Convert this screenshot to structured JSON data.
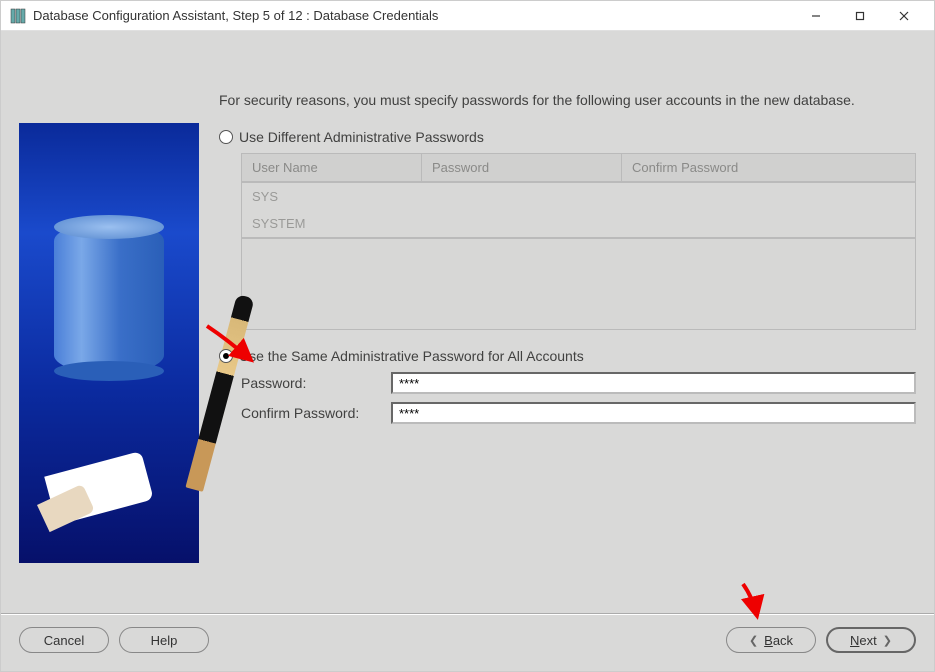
{
  "window": {
    "title": "Database Configuration Assistant, Step 5 of 12 : Database Credentials"
  },
  "content": {
    "intro": "For security reasons, you must specify passwords for the following user accounts in the new database.",
    "radio_different": "Use Different Administrative Passwords",
    "radio_same": "Use the Same Administrative Password for All Accounts",
    "grid": {
      "headers": {
        "user": "User Name",
        "pw": "Password",
        "confirm": "Confirm Password"
      },
      "rows": [
        {
          "user": "SYS",
          "pw": "",
          "confirm": ""
        },
        {
          "user": "SYSTEM",
          "pw": "",
          "confirm": ""
        }
      ]
    },
    "password_label": "Password:",
    "confirm_label": "Confirm Password:",
    "password_value": "****",
    "confirm_value": "****"
  },
  "buttons": {
    "cancel": "Cancel",
    "help": "Help",
    "back": "Back",
    "next": "Next"
  },
  "annotations": {
    "arrow1": "red-arrow",
    "arrow2": "red-arrow"
  }
}
